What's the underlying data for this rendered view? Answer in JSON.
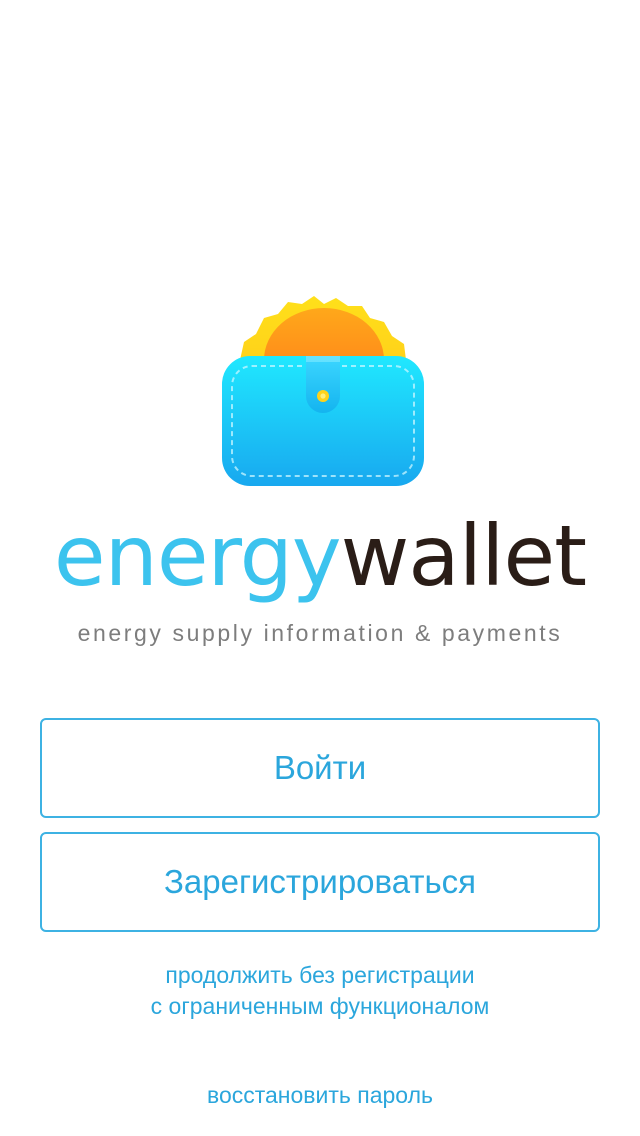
{
  "brand": {
    "part1": "energy",
    "part2": "wallet",
    "tagline": "energy supply information & payments",
    "colors": {
      "accent": "#3cc3ee",
      "dark": "#2a1d17",
      "sun_outer": "#ffe21a",
      "sun_inner": "#ff9a1a",
      "wallet_top": "#1ee6ff",
      "wallet_bottom": "#1aa6ee"
    }
  },
  "auth": {
    "login_label": "Войти",
    "register_label": "Зарегистрироваться",
    "continue_line1": "продолжить без регистрации",
    "continue_line2": "с ограниченным функционалом",
    "restore_label": "восстановить пароль",
    "link_color": "#2ba6dc"
  },
  "icons": {
    "logo": "sun-wallet-icon"
  }
}
